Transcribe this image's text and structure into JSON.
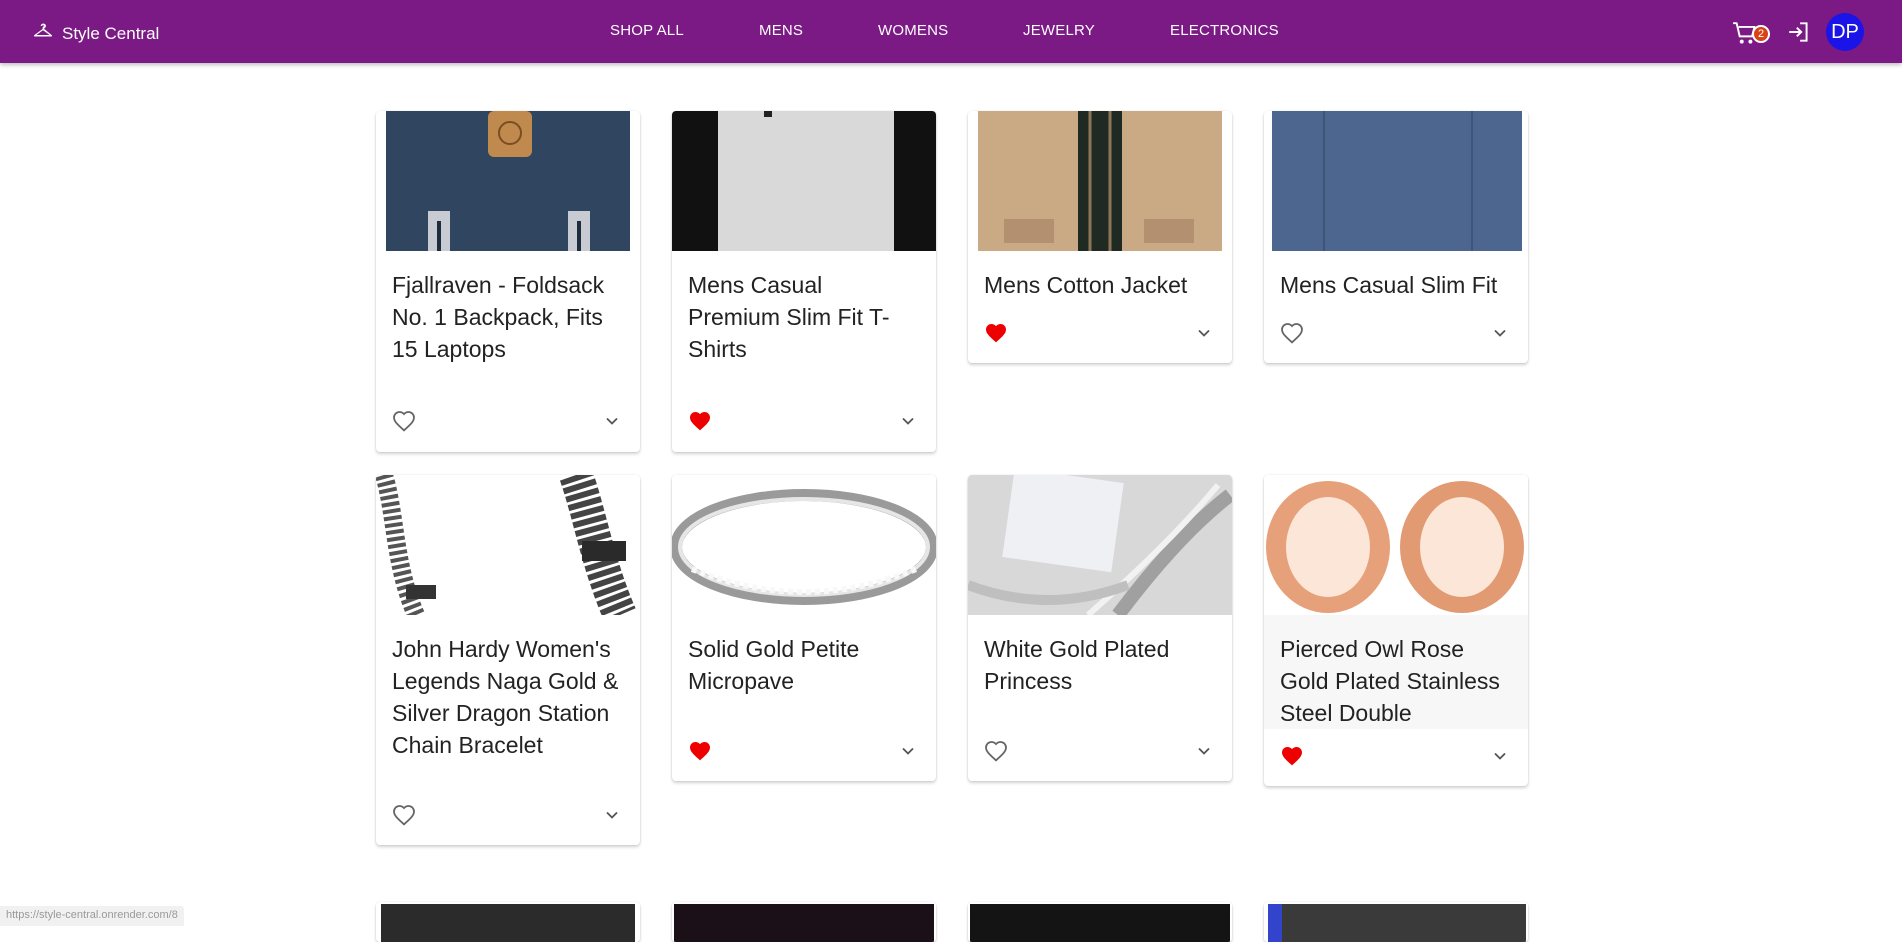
{
  "app": {
    "brand": "Style Central"
  },
  "nav": {
    "items": [
      "SHOP ALL",
      "MENS",
      "WOMENS",
      "JEWELRY",
      "ELECTRONICS"
    ]
  },
  "header": {
    "cart_count": "2",
    "avatar_initials": "DP"
  },
  "products": [
    {
      "title": "Fjallraven - Foldsack No. 1 Backpack, Fits 15 Laptops",
      "favorited": false
    },
    {
      "title": "Mens Casual Premium Slim Fit T-Shirts",
      "favorited": true
    },
    {
      "title": "Mens Cotton Jacket",
      "favorited": true
    },
    {
      "title": "Mens Casual Slim Fit",
      "favorited": false
    },
    {
      "title": "John Hardy Women's Legends Naga Gold & Silver Dragon Station Chain Bracelet",
      "favorited": false
    },
    {
      "title": "Solid Gold Petite Micropave",
      "favorited": true
    },
    {
      "title": "White Gold Plated Princess",
      "favorited": false
    },
    {
      "title": "Pierced Owl Rose Gold Plated Stainless Steel Double",
      "favorited": true
    }
  ],
  "status_url": "https://style-central.onrender.com/8",
  "colors": {
    "appbar": "#7b1a84",
    "favorite": "#ee0000",
    "avatar": "#1a14e8",
    "badge": "#d84315"
  }
}
